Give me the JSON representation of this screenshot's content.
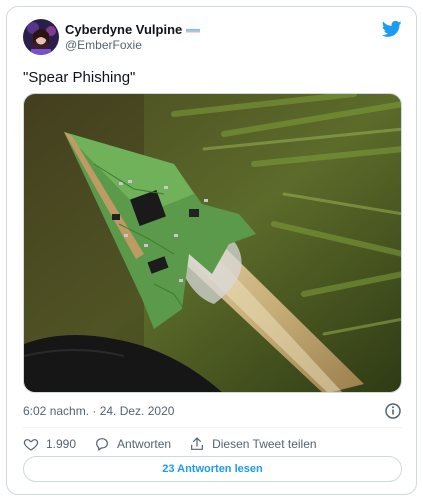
{
  "author": {
    "display_name": "Cyberdyne Vulpine",
    "handle": "@EmberFoxie"
  },
  "tweet": {
    "text": "\"Spear Phishing\"",
    "timestamp": "6:02 nachm. · 24. Dez. 2020"
  },
  "actions": {
    "likes": "1.990",
    "reply_label": "Antworten",
    "share_label": "Diesen Tweet teilen"
  },
  "read_replies_label": "23 Antworten lesen",
  "icons": [
    "twitter-bird-icon",
    "info-icon",
    "heart-icon",
    "reply-icon",
    "share-icon",
    "trans-flag-icon"
  ],
  "colors": {
    "accent": "#1d9bf0",
    "text": "#0f1419",
    "secondary": "#536471",
    "border": "#cfd9de"
  }
}
